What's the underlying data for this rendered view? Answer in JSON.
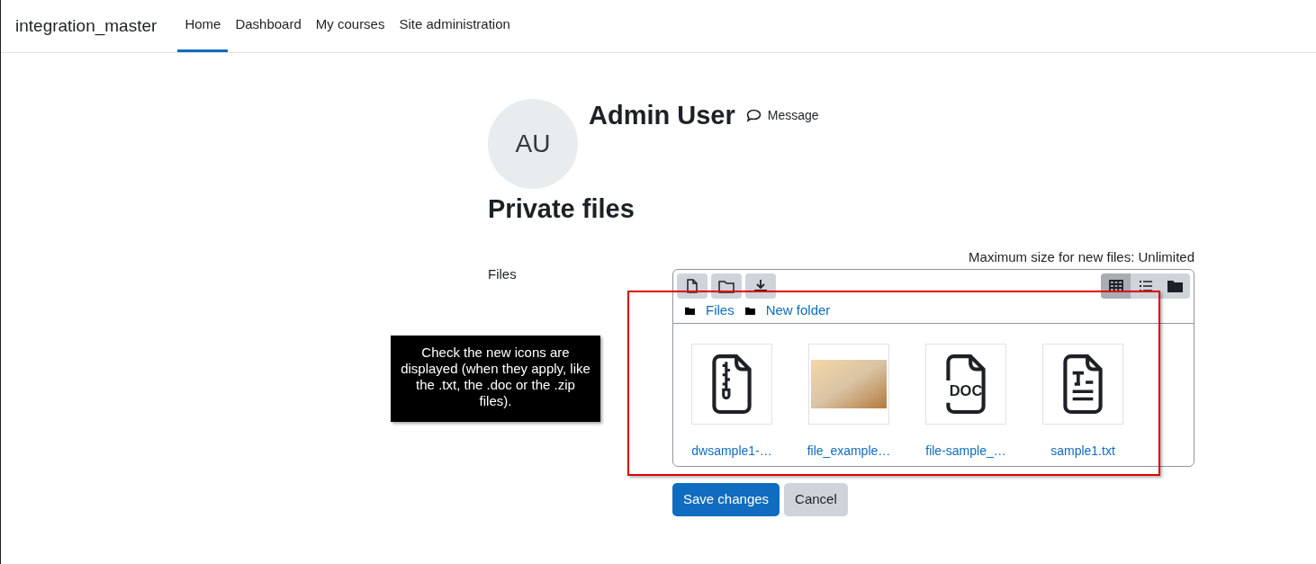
{
  "navbar": {
    "brand": "integration_master",
    "items": [
      {
        "label": "Home",
        "selected": true
      },
      {
        "label": "Dashboard",
        "selected": false
      },
      {
        "label": "My courses",
        "selected": false
      },
      {
        "label": "Site administration",
        "selected": false
      }
    ]
  },
  "profile": {
    "initials": "AU",
    "name": "Admin User",
    "message_link": "Message"
  },
  "page_title": "Private files",
  "form": {
    "label": "Files",
    "max_size": "Maximum size for new files: Unlimited",
    "toolbar": [
      {
        "kind": "file"
      },
      {
        "kind": "folder"
      },
      {
        "kind": "download"
      }
    ],
    "view_modes": [
      {
        "kind": "grid",
        "selected": true
      },
      {
        "kind": "list",
        "selected": false
      },
      {
        "kind": "tree",
        "selected": false
      }
    ],
    "breadcrumb": [
      "Files",
      "New folder"
    ],
    "files": [
      {
        "kind": "zip",
        "name": "dwsample1-…"
      },
      {
        "kind": "image",
        "name": "file_example…"
      },
      {
        "kind": "doc",
        "name": "file-sample_…",
        "icon_text": "DOC"
      },
      {
        "kind": "txt",
        "name": "sample1.txt"
      }
    ],
    "buttons": [
      {
        "label": "Save changes",
        "kind": "primary"
      },
      {
        "label": "Cancel",
        "kind": "secondary"
      }
    ]
  },
  "annotation": {
    "callout": "Check the new icons are displayed (when they apply, like the .txt, the .doc or the .zip files)."
  }
}
